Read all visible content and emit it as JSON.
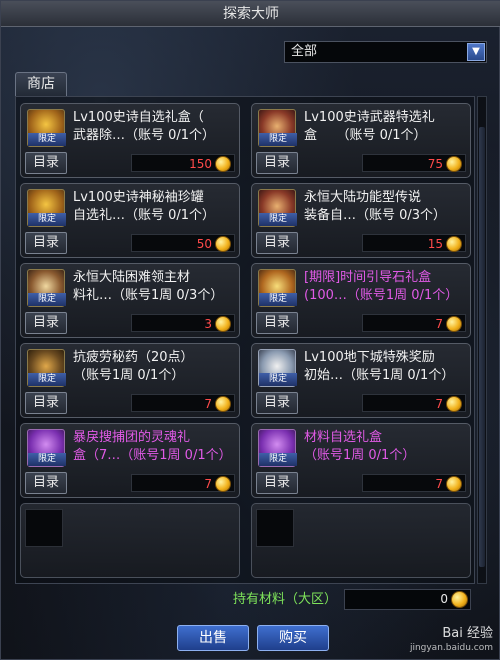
{
  "window": {
    "title": "探索大师"
  },
  "filter": {
    "selected": "全部"
  },
  "tabs": [
    {
      "label": "商店"
    }
  ],
  "items": [
    {
      "name_line1": "Lv100史诗自选礼盒（",
      "name_line2": "武器除…（账号 0/1个）",
      "price": "150",
      "badge": "限定",
      "catalog": "目录",
      "icon": "golden-box-icon",
      "color": "#f2f2f2"
    },
    {
      "name_line1": "Lv100史诗武器特选礼",
      "name_line2": "盒　　（账号 0/1个）",
      "price": "75",
      "badge": "限定",
      "catalog": "目录",
      "icon": "weapon-box-icon",
      "color": "#f2f2f2"
    },
    {
      "name_line1": "Lv100史诗神秘袖珍罐",
      "name_line2": "自选礼…（账号 0/1个）",
      "price": "50",
      "badge": "限定",
      "catalog": "目录",
      "icon": "golden-box-icon",
      "color": "#f2f2f2"
    },
    {
      "name_line1": "永恒大陆功能型传说",
      "name_line2": "装备自…（账号 0/3个）",
      "price": "15",
      "badge": "限定",
      "catalog": "目录",
      "icon": "scroll-box-icon",
      "color": "#f2f2f2"
    },
    {
      "name_line1": "永恒大陆困难领主材",
      "name_line2": "料礼…（账号1周 0/3个）",
      "price": "3",
      "badge": "限定",
      "catalog": "目录",
      "icon": "chest-icon",
      "color": "#f2f2f2"
    },
    {
      "name_line1": "[期限]时间引导石礼盒",
      "name_line2": "(100…（账号1周 0/1个）",
      "price": "7",
      "badge": "限定",
      "catalog": "目录",
      "icon": "stone-box-icon",
      "color": "#e05ae6"
    },
    {
      "name_line1": "抗疲劳秘药（20点）",
      "name_line2": "（账号1周 0/1个）",
      "price": "7",
      "badge": "限定",
      "catalog": "目录",
      "icon": "potion-icon",
      "color": "#f2f2f2"
    },
    {
      "name_line1": "Lv100地下城特殊奖励",
      "name_line2": "初始…（账号1周 0/1个）",
      "price": "7",
      "badge": "限定",
      "catalog": "目录",
      "icon": "reward-paper-icon",
      "color": "#f2f2f2"
    },
    {
      "name_line1": "暴戾搜捕团的灵魂礼",
      "name_line2": "盒（7…（账号1周 0/1个）",
      "price": "7",
      "badge": "限定",
      "catalog": "目录",
      "icon": "soul-box-icon",
      "color": "#e05ae6"
    },
    {
      "name_line1": "材料自选礼盒",
      "name_line2": "（账号1周 0/1个）",
      "price": "7",
      "badge": "限定",
      "catalog": "目录",
      "icon": "material-box-icon",
      "color": "#e05ae6"
    }
  ],
  "holding": {
    "label": "持有材料（大区）",
    "value": "0"
  },
  "buttons": {
    "sell": "出售",
    "buy": "购买"
  },
  "watermark": {
    "line1": "Bai 经验",
    "line2": "jingyan.baidu.com"
  }
}
